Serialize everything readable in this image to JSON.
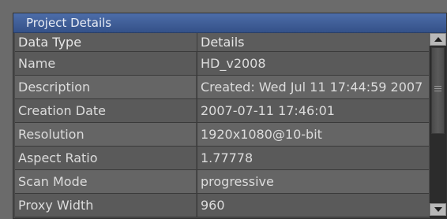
{
  "panel": {
    "title": "Project Details"
  },
  "table": {
    "headers": [
      "Data Type",
      "Details"
    ],
    "rows": [
      [
        "Name",
        "HD_v2008"
      ],
      [
        "Description",
        "Created: Wed Jul 11 17:44:59 2007"
      ],
      [
        "Creation Date",
        "2007-07-11 17:46:01"
      ],
      [
        "Resolution",
        "1920x1080@10-bit"
      ],
      [
        "Aspect Ratio",
        "1.77778"
      ],
      [
        "Scan Mode",
        "progressive"
      ],
      [
        "Proxy Width",
        "960"
      ]
    ]
  }
}
